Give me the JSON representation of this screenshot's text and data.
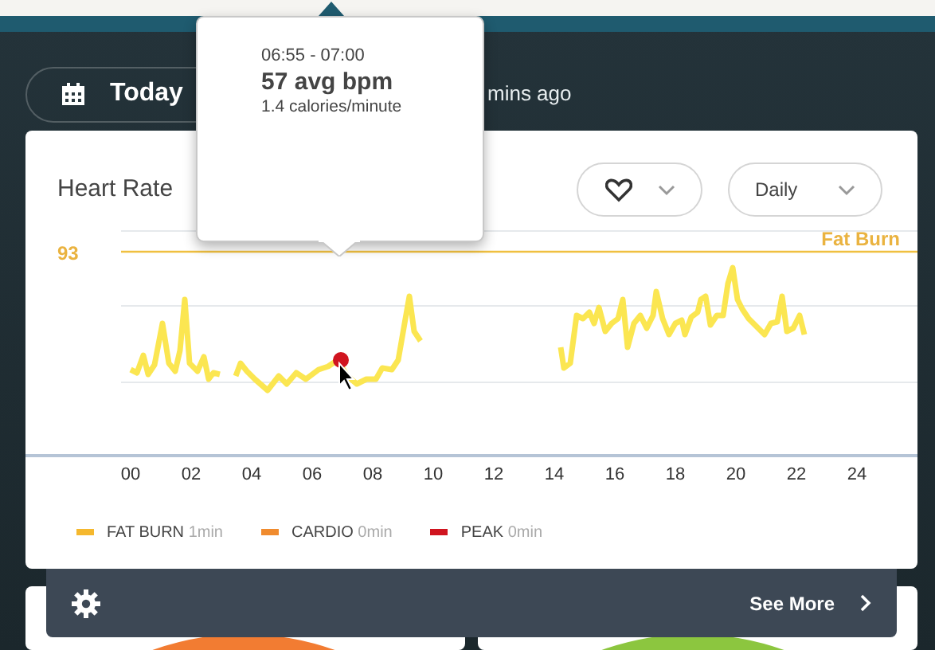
{
  "header": {
    "date_label": "Today",
    "sync_text": "mins ago"
  },
  "tooltip": {
    "time": "06:55 - 07:00",
    "value": "57 avg bpm",
    "rate": "1.4 calories/minute"
  },
  "card": {
    "title": "Heart Rate",
    "period": "Daily",
    "threshold": {
      "value": "93",
      "zone": "Fat Burn"
    },
    "x_tick_labels": [
      "00",
      "02",
      "04",
      "06",
      "08",
      "10",
      "12",
      "14",
      "16",
      "18",
      "20",
      "22",
      "24"
    ],
    "legend": [
      {
        "label": "FAT BURN",
        "duration": "1min",
        "color": "#f5b82e"
      },
      {
        "label": "CARDIO",
        "duration": "0min",
        "color": "#f08b2e"
      },
      {
        "label": "PEAK",
        "duration": "0min",
        "color": "#d0141f"
      }
    ]
  },
  "footer": {
    "link": "See More"
  }
}
